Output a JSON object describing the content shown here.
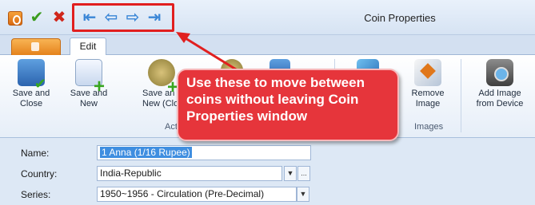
{
  "window": {
    "title": "Coin Properties"
  },
  "quick_access": {
    "save_icon": "check-icon",
    "cancel_icon": "cross-icon",
    "nav": [
      "first-arrow-icon",
      "previous-arrow-icon",
      "next-arrow-icon",
      "last-arrow-icon"
    ]
  },
  "tabs": {
    "edit_label": "Edit"
  },
  "ribbon": {
    "save_close": "Save and\nClose",
    "save_new": "Save and\nNew",
    "save_new_clone": "Save an\nNew (Clo",
    "remove_image": "Remove\nImage",
    "add_image_device": "Add Image\nfrom Device",
    "group_actions": "Actio",
    "group_images": "Images"
  },
  "callout": {
    "text": "Use these to move between coins without leaving Coin Properties window"
  },
  "form": {
    "name_label": "Name:",
    "name_value": "1 Anna (1/16 Rupee)",
    "country_label": "Country:",
    "country_value": "India-Republic",
    "series_label": "Series:",
    "series_value": "1950~1956 - Circulation (Pre-Decimal)",
    "ellipsis": "..."
  },
  "colors": {
    "highlight": "#e11f1f",
    "callout": "#e6353b",
    "nav_arrow": "#3a86d6"
  }
}
